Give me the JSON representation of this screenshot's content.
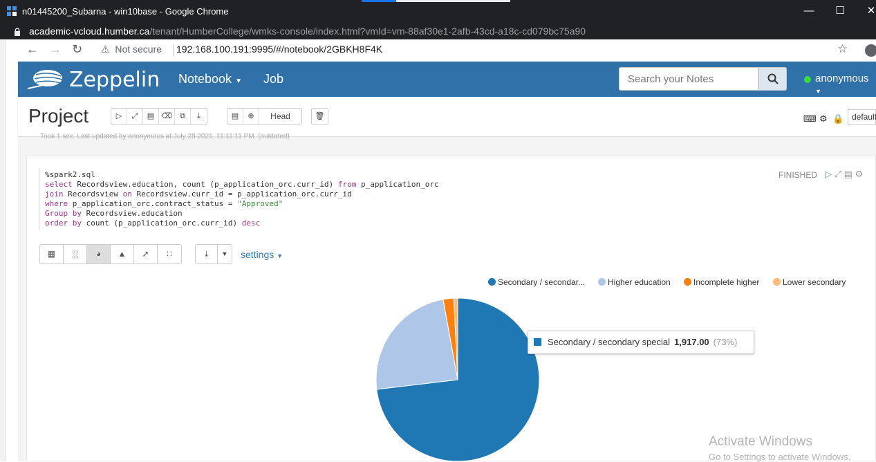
{
  "window": {
    "title": "n01445200_Subarna - win10base - Google Chrome",
    "outer_url_host": "academic-vcloud.humber.ca",
    "outer_url_path": "/tenant/HumberCollege/wmks-console/index.html?vmId=vm-88af30e1-2afb-43cd-a18c-cd079bc75a90"
  },
  "browser": {
    "security": "Not secure",
    "address": "192.168.100.191:9995/#/notebook/2GBKH8F4K"
  },
  "navbar": {
    "brand": "Zeppelin",
    "menu_notebook": "Notebook",
    "menu_job": "Job",
    "search_placeholder": "Search your Notes",
    "user": "anonymous"
  },
  "notebook": {
    "title": "Project",
    "head_label": "Head",
    "default_label": "default",
    "last_run": "Took 1 sec. Last updated by anonymous at July 28 2021, 11:11:11 PM. (outdated)"
  },
  "paragraph": {
    "status": "FINISHED",
    "code": [
      "%spark2.sql",
      "select Recordsview.education, count (p_application_orc.curr_id) from p_application_orc",
      "join Recordsview on Recordsview.curr_id = p_application_orc.curr_id",
      "where p_application_orc.contract_status = \"Approved\"",
      "Group by Recordsview.education",
      "order by count (p_application_orc.curr_id) desc"
    ],
    "settings_label": "settings"
  },
  "chart_data": {
    "type": "pie",
    "legend_position": "top-right",
    "legend_labels": [
      "Secondary / secondar...",
      "Higher education",
      "Incomplete higher",
      "Lower secondary"
    ],
    "categories": [
      "Secondary / secondary special",
      "Higher education",
      "Incomplete higher",
      "Lower secondary"
    ],
    "values": [
      1917,
      630,
      55,
      20
    ],
    "colors": [
      "#1f77b4",
      "#aec7e8",
      "#ff7f0e",
      "#ffbb78"
    ],
    "tooltip": {
      "label": "Secondary / secondary special",
      "value": "1,917.00",
      "percent": "(73%)"
    }
  },
  "overlay": {
    "activate": "Activate Windows",
    "activate_sub": "Go to Settings to activate Windows."
  }
}
